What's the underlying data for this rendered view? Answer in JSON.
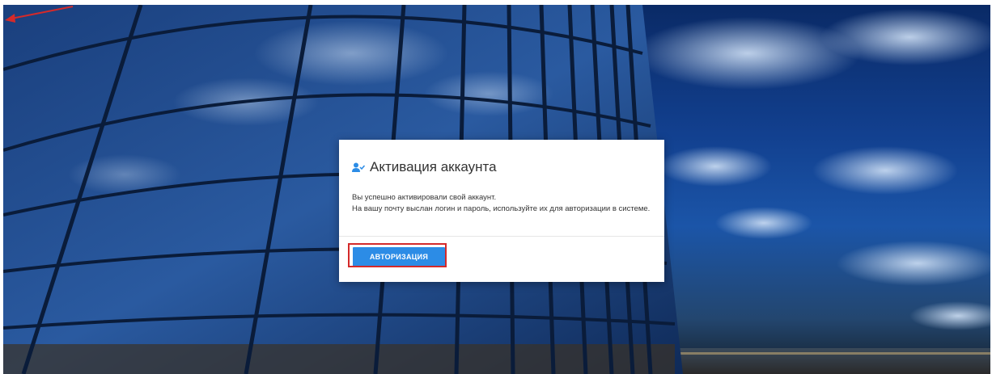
{
  "dialog": {
    "title": "Активация аккаунта",
    "icon": "user-check-icon",
    "message_line1": "Вы успешно активировали свой аккаунт.",
    "message_line2": "На вашу почту выслан логин и пароль, используйте их для авторизации в системе.",
    "login_button_label": "АВТОРИЗАЦИЯ"
  },
  "annotation": {
    "highlight_color": "#d42a2a",
    "arrow_color": "#d42a2a",
    "target": "login-button"
  },
  "colors": {
    "primary_button": "#2c8ce6",
    "sky": "#1b55a8"
  }
}
